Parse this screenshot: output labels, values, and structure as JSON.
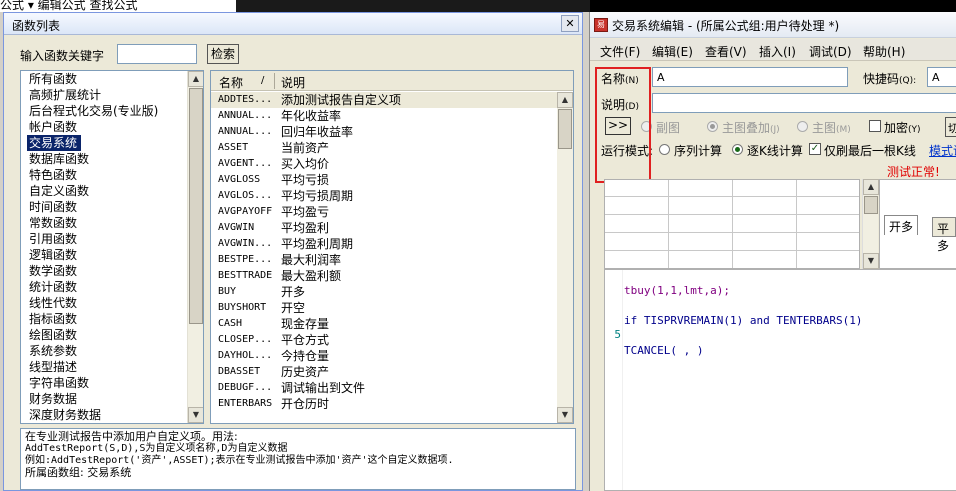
{
  "background_app": {
    "menu_text": "公式 ▾ 编辑公式  查找公式"
  },
  "function_list": {
    "title": "函数列表",
    "keyword_label": "输入函数关键字",
    "keyword_value": "",
    "search_button": "检索",
    "categories": [
      "所有函数",
      "高频扩展统计",
      "后台程式化交易(专业版)",
      "帐户函数",
      "交易系统",
      "数据库函数",
      "特色函数",
      "自定义函数",
      "时间函数",
      "常数函数",
      "引用函数",
      "逻辑函数",
      "数学函数",
      "统计函数",
      "线性代数",
      "指标函数",
      "绘图函数",
      "系统参数",
      "线型描述",
      "字符串函数",
      "财务数据",
      "深度财务数据"
    ],
    "selected_category": "交易系统",
    "columns": {
      "name": "名称",
      "desc": "说明"
    },
    "functions": [
      {
        "name": "ADDTES...",
        "desc": "添加测试报告自定义项"
      },
      {
        "name": "ANNUAL...",
        "desc": "年化收益率"
      },
      {
        "name": "ANNUAL...",
        "desc": "回归年收益率"
      },
      {
        "name": "ASSET",
        "desc": "当前资产"
      },
      {
        "name": "AVGENT...",
        "desc": "买入均价"
      },
      {
        "name": "AVGLOSS",
        "desc": "平均亏损"
      },
      {
        "name": "AVGLOS...",
        "desc": "平均亏损周期"
      },
      {
        "name": "AVGPAYOFF",
        "desc": "平均盈亏"
      },
      {
        "name": "AVGWIN",
        "desc": "平均盈利"
      },
      {
        "name": "AVGWIN...",
        "desc": "平均盈利周期"
      },
      {
        "name": "BESTPE...",
        "desc": "最大利润率"
      },
      {
        "name": "BESTTRADE",
        "desc": "最大盈利额"
      },
      {
        "name": "BUY",
        "desc": "开多"
      },
      {
        "name": "BUYSHORT",
        "desc": "开空"
      },
      {
        "name": "CASH",
        "desc": "现金存量"
      },
      {
        "name": "CLOSEP...",
        "desc": "平仓方式"
      },
      {
        "name": "DAYHOL...",
        "desc": "今持仓量"
      },
      {
        "name": "DBASSET",
        "desc": "历史资产"
      },
      {
        "name": "DEBUGF...",
        "desc": "调试输出到文件"
      },
      {
        "name": "ENTERBARS",
        "desc": "开仓历时"
      }
    ],
    "description": {
      "line1": "在专业测试报告中添加用户自定义项。用法:",
      "line2": "AddTestReport(S,D),S为自定义项名称,D为自定义数据",
      "line3": "例如:AddTestReport('资产',ASSET);表示在专业测试报告中添加'资产'这个自定义数据项.",
      "line4": "所属函数组: 交易系统"
    }
  },
  "editor": {
    "title": "交易系统编辑 - (所属公式组:用户待处理 *)",
    "menu": [
      "文件(F)",
      "编辑(E)",
      "查看(V)",
      "插入(I)",
      "调试(D)",
      "帮助(H)"
    ],
    "name_label": "名称",
    "name_key": "(N)",
    "name_value": "A",
    "shortcut_label": "快捷码",
    "shortcut_key": "(Q):",
    "shortcut_value": "A",
    "desc_label": "说明",
    "desc_key": "(D)",
    "desc_value": "",
    "expand_button": ">>",
    "chart_options": {
      "sub_chart": "副图",
      "main_overlay": "主图叠加",
      "main_overlay_key": "(J)",
      "main_chart": "主图",
      "main_chart_key": "(M)",
      "encrypt": "加密",
      "encrypt_key": "(Y)"
    },
    "run_mode_label": "运行模式:",
    "run_modes": {
      "sequential": "序列计算",
      "per_k": "逐K线计算"
    },
    "last_k_only": "仅刷最后一根K线",
    "mode_link": "模式说",
    "status": "测试正常!",
    "tabs": [
      "开多",
      "平多"
    ],
    "code": {
      "line1": "tbuy(1,1,lmt,a);",
      "line2_kw": "if",
      "line2_a": " TISPRVREMAIN(1) ",
      "line2_b": "and",
      "line2_c": " TENTERBARS(1)",
      "line3_num": "5",
      "line4": "TCANCEL( , )"
    }
  }
}
